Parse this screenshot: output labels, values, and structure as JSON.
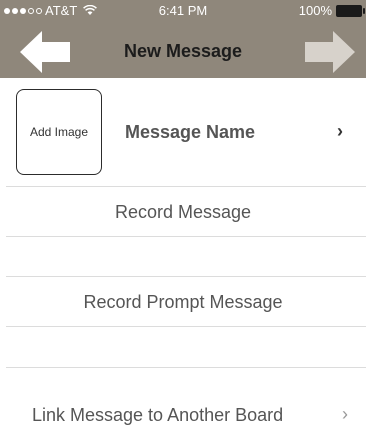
{
  "status_bar": {
    "carrier": "AT&T",
    "time": "6:41 PM",
    "battery": "100%"
  },
  "nav": {
    "title": "New Message",
    "back_icon": "arrow-left-icon",
    "forward_icon": "arrow-right-icon"
  },
  "image_button": {
    "label": "Add Image"
  },
  "message_name": {
    "label": "Message Name",
    "chevron": "›"
  },
  "rows": {
    "record_message": "Record Message",
    "record_prompt": "Record Prompt Message",
    "link_board": "Link Message to Another Board",
    "link_chevron": "›"
  },
  "colors": {
    "navbar": "#8f877b",
    "back_arrow": "#ffffff",
    "forward_arrow": "#d7d2cb"
  }
}
